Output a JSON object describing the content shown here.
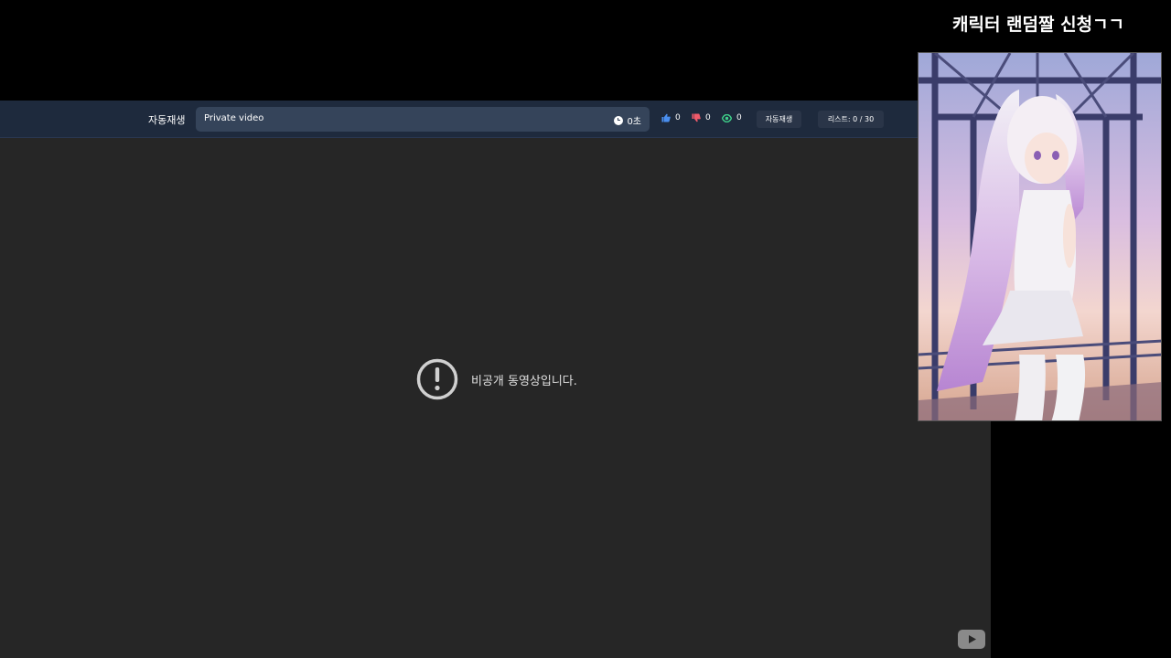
{
  "overlay": {
    "title": "캐릭터 랜덤짤 신청ㄱㄱ"
  },
  "toolbar": {
    "autoplay_label": "자동재생",
    "video_title": "Private video",
    "timer": "0초",
    "likes": "0",
    "dislikes": "0",
    "views": "0",
    "autoplay_button": "자동재생",
    "list_count": "리스트: 0 / 30"
  },
  "player": {
    "error_message": "비공개 동영상입니다."
  },
  "colors": {
    "toolbar_bg": "#1e2a3d",
    "title_box_bg": "#35445a",
    "like_icon": "#4a8ff0",
    "dislike_icon": "#f05a6a",
    "view_icon": "#3fd08a",
    "player_bg": "#262626"
  },
  "icons": [
    "clock-icon",
    "thumbs-up-icon",
    "thumbs-down-icon",
    "eye-icon",
    "exclamation-circle-icon",
    "youtube-logo-icon"
  ]
}
